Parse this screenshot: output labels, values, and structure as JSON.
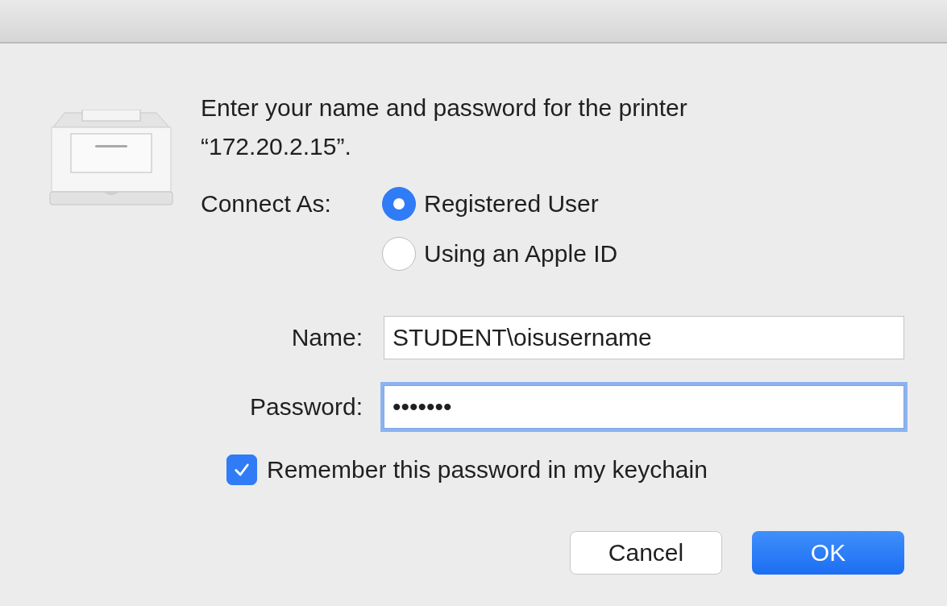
{
  "message": [
    "Enter your name and password for the printer",
    "“172.20.2.15”."
  ],
  "connect_as": {
    "label": "Connect As:",
    "options": [
      {
        "label": "Registered User",
        "selected": true
      },
      {
        "label": "Using an Apple ID",
        "selected": false
      }
    ]
  },
  "fields": [
    {
      "label": "Name:",
      "value": "STUDENT\\oisusername",
      "focused": false
    },
    {
      "label": "Password:",
      "value": "•••••••",
      "focused": true
    }
  ],
  "remember": {
    "label": "Remember this password in my keychain",
    "checked": true
  },
  "buttons": [
    {
      "label": "Cancel",
      "kind": "secondary"
    },
    {
      "label": "OK",
      "kind": "default"
    }
  ]
}
